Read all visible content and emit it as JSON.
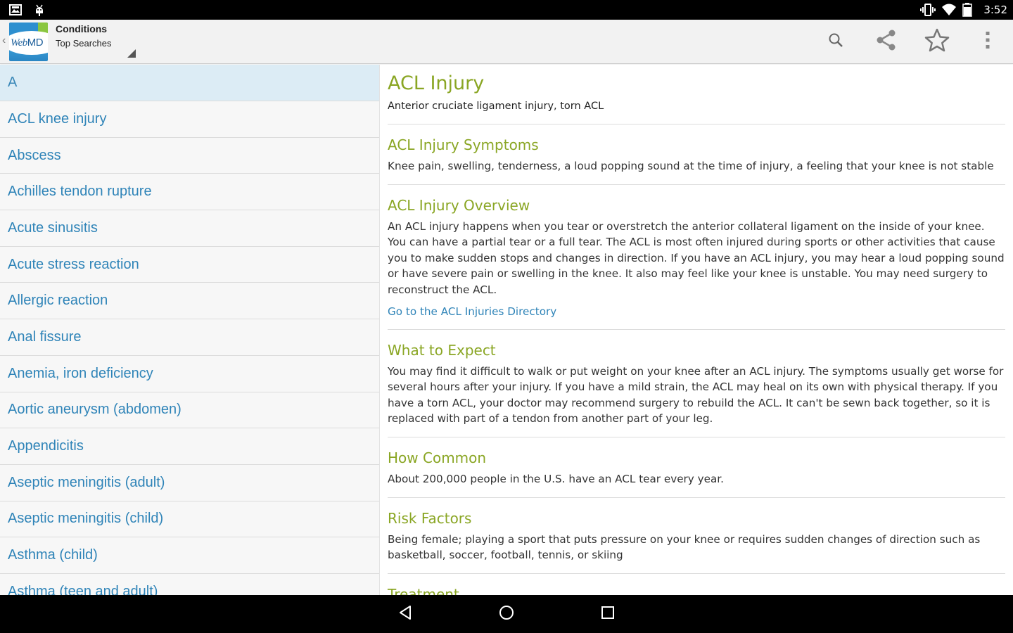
{
  "status_bar": {
    "time": "3:52",
    "left_icons": [
      "gallery-notification-icon",
      "android-debug-icon"
    ],
    "right_icons": [
      "vibrate-icon",
      "wifi-icon",
      "battery-icon"
    ]
  },
  "action_bar": {
    "logo_text_a": "Web",
    "logo_text_b": "MD",
    "title": "Conditions",
    "subtitle": "Top Searches",
    "actions": [
      "search-icon",
      "share-icon",
      "star-icon",
      "overflow-menu-icon"
    ]
  },
  "list": {
    "header": "A",
    "items": [
      "ACL knee injury",
      "Abscess",
      "Achilles tendon rupture",
      "Acute sinusitis",
      "Acute stress reaction",
      "Allergic reaction",
      "Anal fissure",
      "Anemia, iron deficiency",
      "Aortic aneurysm (abdomen)",
      "Appendicitis",
      "Aseptic meningitis (adult)",
      "Aseptic meningitis (child)",
      "Asthma (child)",
      "Asthma (teen and adult)"
    ]
  },
  "detail": {
    "title": "ACL Injury",
    "subtitle": "Anterior cruciate ligament injury, torn ACL",
    "sections": [
      {
        "title": "ACL Injury Symptoms",
        "body": "Knee pain, swelling, tenderness, a loud popping sound at the time of injury, a feeling that your knee is not stable",
        "link": ""
      },
      {
        "title": "ACL Injury Overview",
        "body": "An ACL injury happens when you tear or overstretch the anterior collateral ligament on the inside of your knee. You can have a partial tear or a full tear. The ACL is most often injured during sports or other activities that cause you to make sudden stops and changes in direction. If you have an ACL injury, you may hear a loud popping sound or have severe pain or swelling in the knee. It also may feel like your knee is unstable. You may need surgery to reconstruct the ACL.",
        "link": "Go to the ACL Injuries Directory"
      },
      {
        "title": "What to Expect",
        "body": "You may find it difficult to walk or put weight on your knee after an ACL injury. The symptoms usually get worse for several hours after your injury. If you have a mild strain, the ACL may heal on its own with physical therapy. If you have a torn ACL, your doctor may recommend surgery to rebuild the ACL. It can't be sewn back together, so it is replaced with part of a tendon from another part of your leg.",
        "link": ""
      },
      {
        "title": "How Common",
        "body": "About 200,000 people in the U.S. have an ACL tear every year.",
        "link": ""
      },
      {
        "title": "Risk Factors",
        "body": "Being female; playing a sport that puts pressure on your knee or requires sudden changes of direction such as basketball, soccer, football, tennis, or skiing",
        "link": ""
      },
      {
        "title": "Treatment",
        "body": "",
        "link": ""
      }
    ]
  },
  "nav_bar": {
    "buttons": [
      "back-icon",
      "home-icon",
      "recents-icon"
    ]
  },
  "colors": {
    "accent_green": "#8aa624",
    "link_blue": "#2f84b8",
    "list_header_bg": "#dcecf5"
  }
}
